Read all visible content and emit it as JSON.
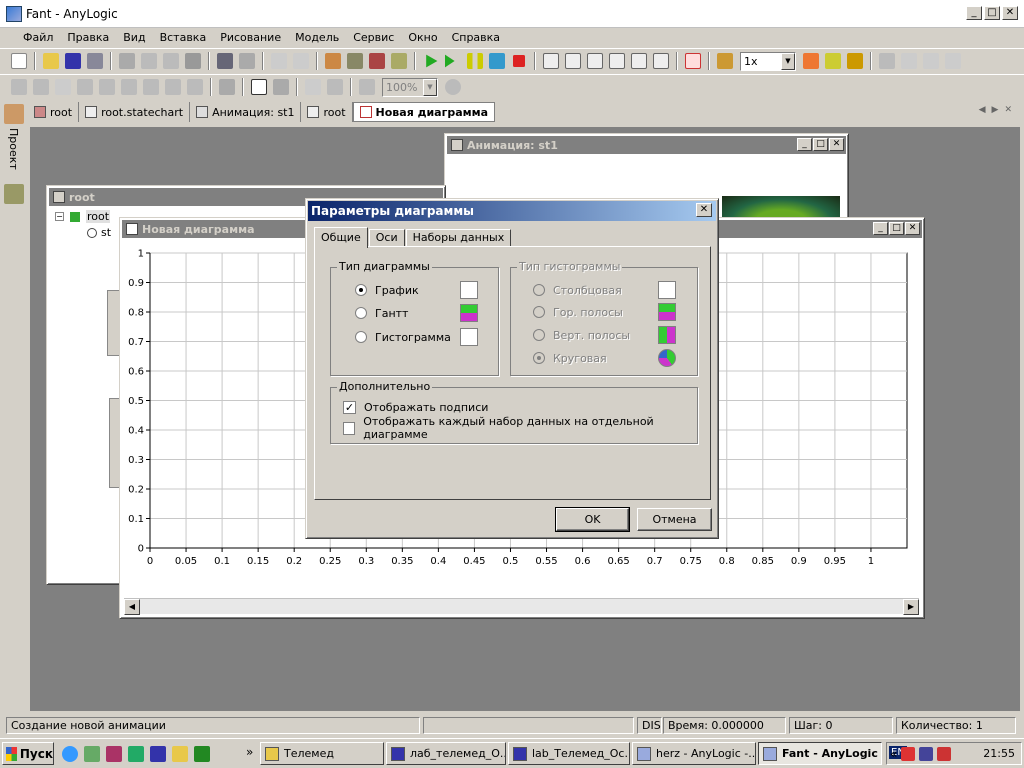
{
  "window": {
    "title": "Fant - AnyLogic",
    "minimize": "_",
    "maximize": "□",
    "close": "✕"
  },
  "menu": [
    "Файл",
    "Правка",
    "Вид",
    "Вставка",
    "Рисование",
    "Модель",
    "Сервис",
    "Окно",
    "Справка"
  ],
  "toolbar": {
    "speed_value": "1x",
    "zoom_value": "100%"
  },
  "left_panel": {
    "project_label": "Проект"
  },
  "tabs": [
    {
      "label": "root",
      "icon": "class-icon"
    },
    {
      "label": "root.statechart",
      "icon": "statechart-icon"
    },
    {
      "label": "Анимация: st1",
      "icon": "animation-icon"
    },
    {
      "label": "root",
      "icon": "structure-icon"
    },
    {
      "label": "Новая диаграмма",
      "icon": "chart-icon",
      "active": true
    }
  ],
  "mdi": {
    "animation_title": "Анимация: st1",
    "root_title": "root",
    "root_tree_item": "root",
    "root_tree_child": "st",
    "chart_title": "Новая диаграмма"
  },
  "chart_data": {
    "type": "line",
    "title": "",
    "xlabel": "",
    "ylabel": "",
    "xlim": [
      0,
      1.05
    ],
    "ylim": [
      0,
      1
    ],
    "x_ticks": [
      "0",
      "0.05",
      "0.1",
      "0.15",
      "0.2",
      "0.25",
      "0.3",
      "0.35",
      "0.4",
      "0.45",
      "0.5",
      "0.55",
      "0.6",
      "0.65",
      "0.7",
      "0.75",
      "0.8",
      "0.85",
      "0.9",
      "0.95",
      "1"
    ],
    "y_ticks": [
      "0",
      "0.1",
      "0.2",
      "0.3",
      "0.4",
      "0.5",
      "0.6",
      "0.7",
      "0.8",
      "0.9",
      "1"
    ],
    "grid": true,
    "series": []
  },
  "dialog": {
    "title": "Параметры диаграммы",
    "close": "✕",
    "tabs": [
      "Общие",
      "Оси",
      "Наборы данных"
    ],
    "chart_type_group": "Тип диаграммы",
    "chart_types": [
      "График",
      "Гантт",
      "Гистограмма"
    ],
    "hist_type_group": "Тип гистограммы",
    "hist_types": [
      "Столбцовая",
      "Гор. полосы",
      "Верт. полосы",
      "Круговая"
    ],
    "extra_group": "Дополнительно",
    "show_labels": "Отображать подписи",
    "separate_charts": "Отображать каждый набор данных на отдельной диаграмме",
    "ok": "OK",
    "cancel": "Отмена"
  },
  "status": {
    "message": "Создание новой анимации",
    "mode": "DIS",
    "time": "Время: 0.000000",
    "step": "Шаг: 0",
    "count": "Количество: 1"
  },
  "taskbar": {
    "start": "Пуск",
    "more": "»",
    "tasks": [
      "Телемед",
      "лаб_телемед_О...",
      "lab_Телемед_Ос...",
      "herz - AnyLogic -...",
      "Fant - AnyLogic"
    ],
    "lang": "EN",
    "tray_more": "«",
    "clock": "21:55"
  }
}
